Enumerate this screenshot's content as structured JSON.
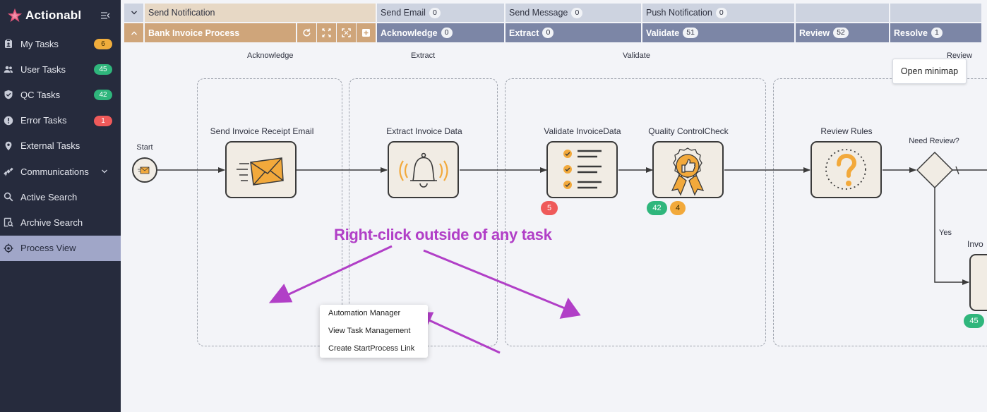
{
  "brand": {
    "name": "Actionabl"
  },
  "sidebar": {
    "items": [
      {
        "label": "My Tasks",
        "icon": "clipboard-icon",
        "badge": "6",
        "badge_color": "#f0ad3c"
      },
      {
        "label": "User Tasks",
        "icon": "users-icon",
        "badge": "45",
        "badge_color": "#2fb67c"
      },
      {
        "label": "QC Tasks",
        "icon": "shield-check-icon",
        "badge": "42",
        "badge_color": "#2fb67c"
      },
      {
        "label": "Error Tasks",
        "icon": "alert-circle-icon",
        "badge": "1",
        "badge_color": "#ef5a5a"
      },
      {
        "label": "External Tasks",
        "icon": "map-pin-icon"
      },
      {
        "label": "Communications",
        "icon": "satellite-icon"
      },
      {
        "label": "Active Search",
        "icon": "search-icon"
      },
      {
        "label": "Archive Search",
        "icon": "archive-search-icon"
      },
      {
        "label": "Process View",
        "icon": "target-icon",
        "active": true
      }
    ]
  },
  "header": {
    "row1": {
      "process": "Send Notification",
      "cols": [
        {
          "label": "Send Email",
          "count": "0"
        },
        {
          "label": "Send Message",
          "count": "0"
        },
        {
          "label": "Push Notification",
          "count": "0"
        }
      ]
    },
    "row2": {
      "process": "Bank Invoice Process",
      "cols": [
        {
          "label": "Acknowledge",
          "count": "0"
        },
        {
          "label": "Extract",
          "count": "0"
        },
        {
          "label": "Validate",
          "count": "51"
        },
        {
          "label": "Review",
          "count": "52"
        },
        {
          "label": "Resolve",
          "count": "1"
        }
      ]
    }
  },
  "lanes": [
    "Acknowledge",
    "Extract",
    "Validate",
    "Review"
  ],
  "flow": {
    "start_label": "Start",
    "tasks": [
      {
        "label": "Send Invoice Receipt Email",
        "icon": "envelope-icon"
      },
      {
        "label": "Extract Invoice Data",
        "icon": "bell-icon"
      },
      {
        "label": "Validate InvoiceData",
        "icon": "checklist-icon",
        "counts": [
          "5"
        ]
      },
      {
        "label": "Quality ControlCheck",
        "icon": "award-icon",
        "counts": [
          "42",
          "4"
        ]
      },
      {
        "label": "Review Rules",
        "icon": "question-icon"
      },
      {
        "label": "Invo",
        "icon": "task-icon",
        "counts": [
          "45"
        ]
      }
    ],
    "gateway_label": "Need Review?",
    "yes_label": "Yes"
  },
  "minimap_button": "Open minimap",
  "context_menu": {
    "items": [
      "Automation Manager",
      "View Task Management",
      "Create StartProcess Link"
    ]
  },
  "annotation": "Right-click outside of any task",
  "colors": {
    "sidebar_bg": "#262b3d",
    "accent": "#b13fc7",
    "task_fill": "#f1ece4",
    "icon_orange": "#f2a93b"
  }
}
